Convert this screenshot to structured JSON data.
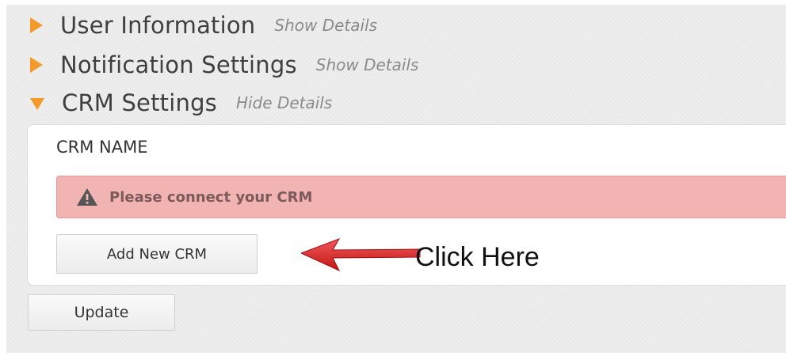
{
  "sections": [
    {
      "title": "User Information",
      "toggle": "Show Details",
      "expanded": false
    },
    {
      "title": "Notification Settings",
      "toggle": "Show Details",
      "expanded": false
    },
    {
      "title": "CRM Settings",
      "toggle": "Hide Details",
      "expanded": true
    }
  ],
  "crm": {
    "name_label": "CRM NAME",
    "alert_text": "Please connect your CRM",
    "add_button": "Add New CRM"
  },
  "update_button": "Update",
  "annotation": {
    "text": "Click Here"
  },
  "colors": {
    "accent_triangle": "#f39a2b",
    "alert_background": "#f2b3b3",
    "annotation_arrow": "#e2292a"
  }
}
